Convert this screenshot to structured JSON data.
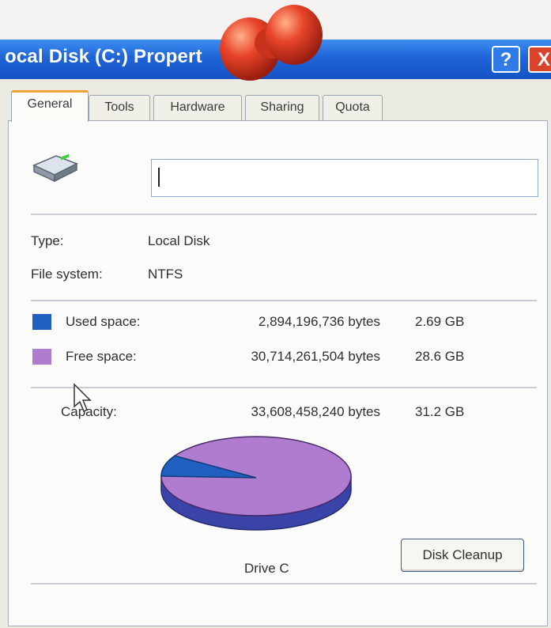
{
  "window": {
    "title": "ocal Disk (C:) Propert",
    "help_label": "?",
    "close_label": "X",
    "titlebar_color": "#1f64d8",
    "close_color": "#d9432c"
  },
  "tabs": [
    {
      "label": "General",
      "active": true
    },
    {
      "label": "Tools",
      "active": false
    },
    {
      "label": "Hardware",
      "active": false
    },
    {
      "label": "Sharing",
      "active": false
    },
    {
      "label": "Quota",
      "active": false
    }
  ],
  "general": {
    "drive_icon": "drive-icon",
    "name_value": "",
    "type_label": "Type:",
    "type_value": "Local Disk",
    "fs_label": "File system:",
    "fs_value": "NTFS",
    "used": {
      "label": "Used space:",
      "bytes": "2,894,196,736 bytes",
      "size": "2.69 GB",
      "color": "#1f5fbf"
    },
    "free": {
      "label": "Free space:",
      "bytes": "30,714,261,504 bytes",
      "size": "28.6 GB",
      "color": "#b07ccf"
    },
    "capacity": {
      "label": "Capacity:",
      "bytes": "33,608,458,240 bytes",
      "size": "31.2 GB"
    },
    "pie": {
      "used_fraction": 0.086
    },
    "drive_label": "Drive C",
    "cleanup_label": "Disk Cleanup"
  }
}
